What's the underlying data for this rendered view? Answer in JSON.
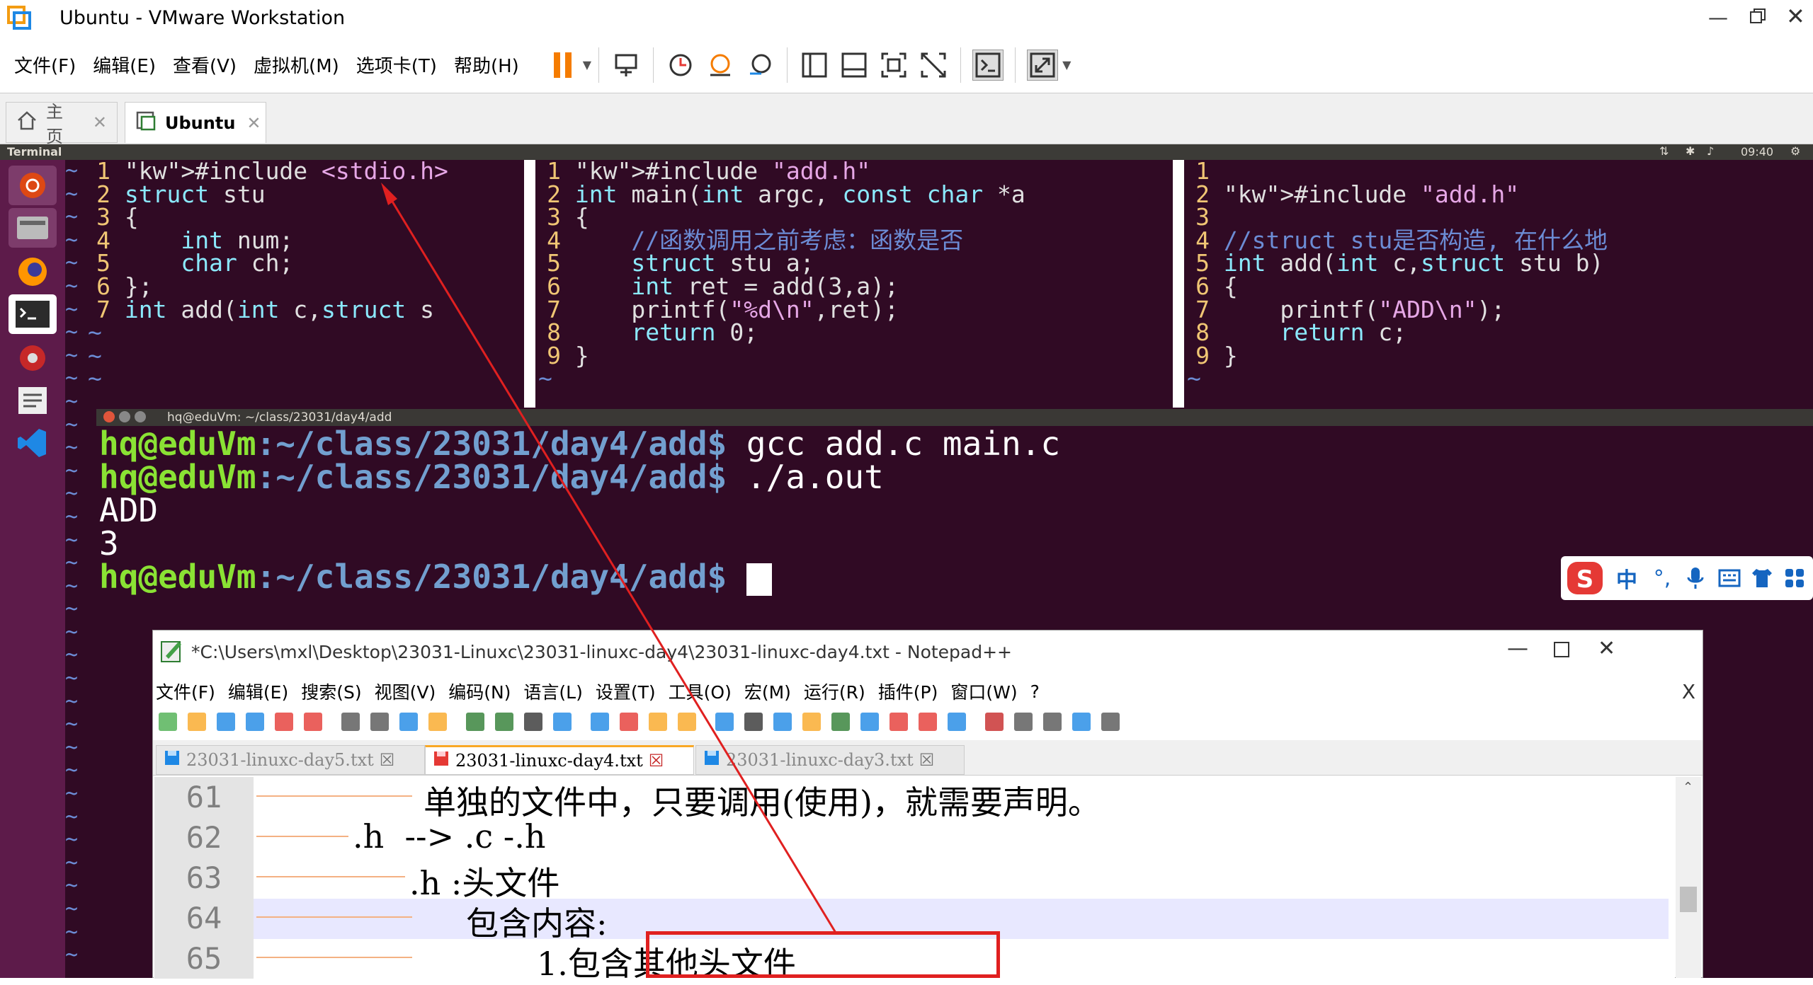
{
  "window": {
    "title": "Ubuntu - VMware Workstation"
  },
  "menu": [
    "文件(F)",
    "编辑(E)",
    "查看(V)",
    "虚拟机(M)",
    "选项卡(T)",
    "帮助(H)"
  ],
  "tabs": [
    {
      "label": "主页"
    },
    {
      "label": "Ubuntu"
    }
  ],
  "ubuntu_bar": {
    "app": "Terminal",
    "clock": "09:40"
  },
  "pane1": {
    "numbers": [
      "1",
      "2",
      "3",
      "4",
      "5",
      "6",
      "7"
    ],
    "lines": [
      "#include <stdio.h>",
      "struct stu",
      "{",
      "    int num;",
      "    char ch;",
      "};",
      "int add(int c,struct s"
    ]
  },
  "pane2": {
    "numbers": [
      "1",
      "2",
      "3",
      "4",
      "5",
      "6",
      "7",
      "8",
      "9"
    ],
    "lines": [
      "#include \"add.h\"",
      "int main(int argc, const char *a",
      "{",
      "    //函数调用之前考虑：函数是否",
      "    struct stu a;",
      "    int ret = add(3,a);",
      "    printf(\"%d\\n\",ret);",
      "    return 0;",
      "}"
    ]
  },
  "pane3": {
    "numbers": [
      "1",
      "2",
      "3",
      "4",
      "5",
      "6",
      "7",
      "8",
      "9"
    ],
    "lines": [
      "",
      "#include \"add.h\"",
      "",
      "//struct stu是否构造, 在什么地",
      "int add(int c,struct stu b)",
      "{",
      "    printf(\"ADD\\n\");",
      "    return c;",
      "}"
    ]
  },
  "vim_tilde": "~",
  "terminal": {
    "title": "hq@eduVm: ~/class/23031/day4/add",
    "user": "hq@eduVm",
    "path": ":~/class/23031/day4/add$",
    "cmd1": " gcc add.c main.c",
    "cmd2": " ./a.out",
    "out1": "ADD",
    "out2": "3"
  },
  "ime": {
    "logo": "S",
    "items": [
      "中",
      "°,"
    ]
  },
  "notepad": {
    "title": "*C:\\Users\\mxl\\Desktop\\23031-Linuxc\\23031-linuxc-day4\\23031-linuxc-day4.txt - Notepad++",
    "menu": [
      "文件(F)",
      "编辑(E)",
      "搜索(S)",
      "视图(V)",
      "编码(N)",
      "语言(L)",
      "设置(T)",
      "工具(O)",
      "宏(M)",
      "运行(R)",
      "插件(P)",
      "窗口(W)",
      "?"
    ],
    "close_x": "X",
    "tabs": [
      "23031-linuxc-day5.txt",
      "23031-linuxc-day4.txt",
      "23031-linuxc-day3.txt"
    ],
    "lines": [
      {
        "num": "61",
        "text": "单独的文件中，只要调用(使用)，就需要声明。"
      },
      {
        "num": "62",
        "text": ".h  --> .c -.h"
      },
      {
        "num": "63",
        "text": ".h :头文件"
      },
      {
        "num": "64",
        "text": "包含内容:"
      },
      {
        "num": "65",
        "text": "1.包含其他头文件"
      }
    ]
  },
  "colors": {
    "accent_red": "#e02020",
    "terminal_bg": "#300a24",
    "launcher_bg": "#5d1b4a"
  }
}
